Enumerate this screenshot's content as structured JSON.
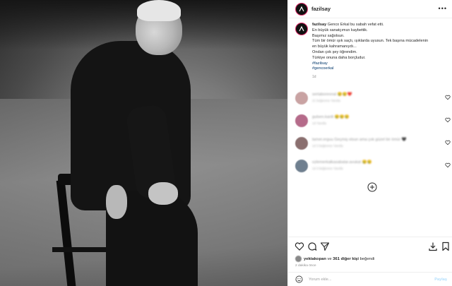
{
  "post": {
    "username": "fazilsay",
    "more_icon": "more-horizontal-icon"
  },
  "caption": {
    "username": "fazilsay",
    "lines": [
      "Genco Erkal bu sabah vefat etti.",
      "En büyük sanatçımızı kaybettik.",
      "Başımız sağolsun.",
      "Tüm bir ömür ışık saçtı, ışıklarda uyusun. Tek başına mücadelenin",
      "en büyük kahramanıydı...",
      "Ondan çok şey öğrendim.",
      "Türkiye onuna daha borçludur."
    ],
    "hashtags": [
      "#fazilsay",
      "#gencoerkal"
    ],
    "time": "1d"
  },
  "comments": [
    {
      "text": "sertaboreonal 😢😢❤️",
      "meta": "21 beğenme   Yanıtla",
      "avatar_color": "#c9a3a3"
    },
    {
      "text": "gulsen.kardi 😢😢😢",
      "meta": "1d   Yanıtla",
      "avatar_color": "#b56b8a"
    },
    {
      "text": "tamer.erguu Geçmiş olsun ama çok güzel bir ömür 🖤",
      "meta": "1d   3 beğenme   Yanıtla",
      "avatar_color": "#8a6f6f"
    },
    {
      "text": "ozlemerkalkasabalar.avukat 😢😢",
      "meta": "1d   3 beğenme   Yanıtla",
      "avatar_color": "#6f7f8f"
    }
  ],
  "likes": {
    "first_user": "yektakopan",
    "connector": "ve",
    "others": "361 diğer kişi",
    "suffix": "beğendi"
  },
  "post_time": "2 dakika önce",
  "comment_box": {
    "placeholder": "Yorum ekle...",
    "post_label": "Paylaş"
  },
  "colors": {
    "accent_link": "#00376b",
    "muted": "#8e8e8e",
    "post_button": "#b2dffc",
    "story_ring": "#e1306c"
  }
}
